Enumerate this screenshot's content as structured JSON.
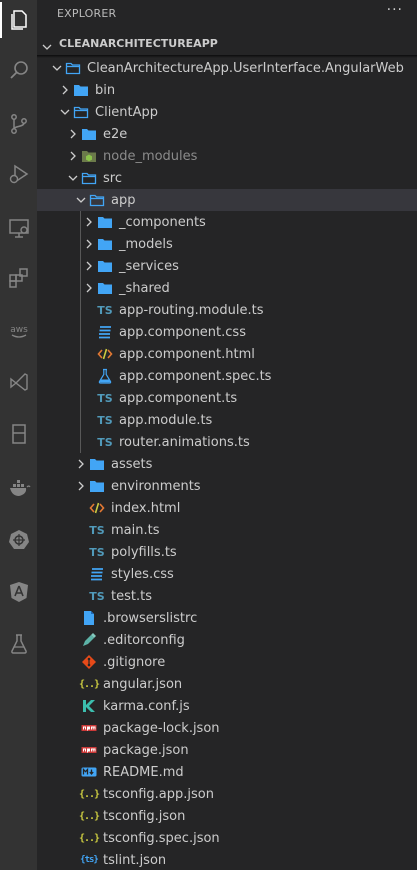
{
  "explorer": {
    "title": "EXPLORER",
    "more": "···",
    "root_label": "CLEANARCHITECTUREAPP"
  },
  "activity_bar": [
    "explorer-icon",
    "search-icon",
    "source-control-icon",
    "run-debug-icon",
    "remote-explorer-icon",
    "extensions-icon",
    "aws-icon",
    "visual-studio-icon",
    "database-icon",
    "docker-icon",
    "kubernetes-icon",
    "angular-icon",
    "testing-icon"
  ],
  "tree": [
    {
      "label": "CleanArchitectureApp.UserInterface.AngularWeb",
      "type": "folder",
      "open": true,
      "depth": 0
    },
    {
      "label": "bin",
      "type": "folder",
      "open": false,
      "depth": 1
    },
    {
      "label": "ClientApp",
      "type": "folder",
      "open": true,
      "depth": 1
    },
    {
      "label": "e2e",
      "type": "folder",
      "open": false,
      "depth": 2
    },
    {
      "label": "node_modules",
      "type": "folder-node",
      "open": false,
      "depth": 2,
      "dim": true
    },
    {
      "label": "src",
      "type": "folder",
      "open": true,
      "depth": 2
    },
    {
      "label": "app",
      "type": "folder",
      "open": true,
      "depth": 3,
      "selected": true
    },
    {
      "label": "_components",
      "type": "folder",
      "open": false,
      "depth": 4
    },
    {
      "label": "_models",
      "type": "folder",
      "open": false,
      "depth": 4
    },
    {
      "label": "_services",
      "type": "folder",
      "open": false,
      "depth": 4
    },
    {
      "label": "_shared",
      "type": "folder",
      "open": false,
      "depth": 4
    },
    {
      "label": "app-routing.module.ts",
      "type": "ts",
      "depth": 4
    },
    {
      "label": "app.component.css",
      "type": "css",
      "depth": 4
    },
    {
      "label": "app.component.html",
      "type": "html",
      "depth": 4
    },
    {
      "label": "app.component.spec.ts",
      "type": "spec",
      "depth": 4
    },
    {
      "label": "app.component.ts",
      "type": "ts",
      "depth": 4
    },
    {
      "label": "app.module.ts",
      "type": "ts",
      "depth": 4
    },
    {
      "label": "router.animations.ts",
      "type": "ts",
      "depth": 4
    },
    {
      "label": "assets",
      "type": "folder",
      "open": false,
      "depth": 3
    },
    {
      "label": "environments",
      "type": "folder",
      "open": false,
      "depth": 3
    },
    {
      "label": "index.html",
      "type": "html",
      "depth": 3
    },
    {
      "label": "main.ts",
      "type": "ts",
      "depth": 3
    },
    {
      "label": "polyfills.ts",
      "type": "ts",
      "depth": 3
    },
    {
      "label": "styles.css",
      "type": "css",
      "depth": 3
    },
    {
      "label": "test.ts",
      "type": "ts",
      "depth": 3
    },
    {
      "label": ".browserslistrc",
      "type": "file",
      "depth": 2
    },
    {
      "label": ".editorconfig",
      "type": "editorconfig",
      "depth": 2
    },
    {
      "label": ".gitignore",
      "type": "git",
      "depth": 2
    },
    {
      "label": "angular.json",
      "type": "json",
      "depth": 2
    },
    {
      "label": "karma.conf.js",
      "type": "karma",
      "depth": 2
    },
    {
      "label": "package-lock.json",
      "type": "npm",
      "depth": 2
    },
    {
      "label": "package.json",
      "type": "npm",
      "depth": 2
    },
    {
      "label": "README.md",
      "type": "md",
      "depth": 2
    },
    {
      "label": "tsconfig.app.json",
      "type": "json",
      "depth": 2
    },
    {
      "label": "tsconfig.json",
      "type": "json",
      "depth": 2
    },
    {
      "label": "tsconfig.spec.json",
      "type": "json",
      "depth": 2
    },
    {
      "label": "tslint.json",
      "type": "tslint",
      "depth": 2
    }
  ],
  "colors": {
    "activity_bar": "#333333",
    "sidebar": "#252526",
    "selected_row": "#37373d",
    "folder": "#42a5f5",
    "ts": "#519aba",
    "html": "#e37933",
    "json": "#cbcb41",
    "npm": "#cb3837"
  }
}
